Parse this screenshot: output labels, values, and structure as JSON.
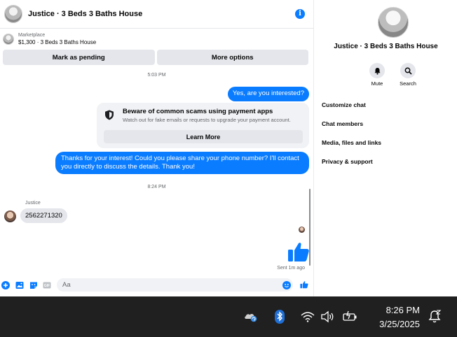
{
  "chat": {
    "header_title": "Justice · 3 Beds 3 Baths House",
    "listing": {
      "source": "Marketplace",
      "price_title": "$1,300 · 3 Beds 3 Baths House"
    },
    "actions": {
      "mark_pending": "Mark as pending",
      "more_options": "More options"
    },
    "messages": {
      "time_1": "5:03 PM",
      "outgoing_1": "Yes, are you interested?",
      "scam_title": "Beware of common scams using payment apps",
      "scam_subtitle": "Watch out for fake emails or requests to upgrade your payment account.",
      "learn_more": "Learn More",
      "outgoing_2": "Thanks for your interest! Could you please share your phone number? I'll contact you directly to discuss the details. Thank you!",
      "time_2": "8:24 PM",
      "sender_name": "Justice",
      "incoming_1": "2562271320",
      "sent_status": "Sent 1m ago"
    },
    "composer": {
      "placeholder": "Aa"
    },
    "accent_color": "#0a7cff"
  },
  "details": {
    "title": "Justice · 3 Beds 3 Baths House",
    "mute_label": "Mute",
    "search_label": "Search",
    "menu": [
      "Customize chat",
      "Chat members",
      "Media, files and links",
      "Privacy & support"
    ]
  },
  "taskbar": {
    "time": "8:26 PM",
    "date": "3/25/2025",
    "tray_icons": [
      "onedrive-icon",
      "bluetooth-icon",
      "wifi-icon",
      "volume-icon",
      "battery-icon",
      "notifications-icon"
    ]
  }
}
